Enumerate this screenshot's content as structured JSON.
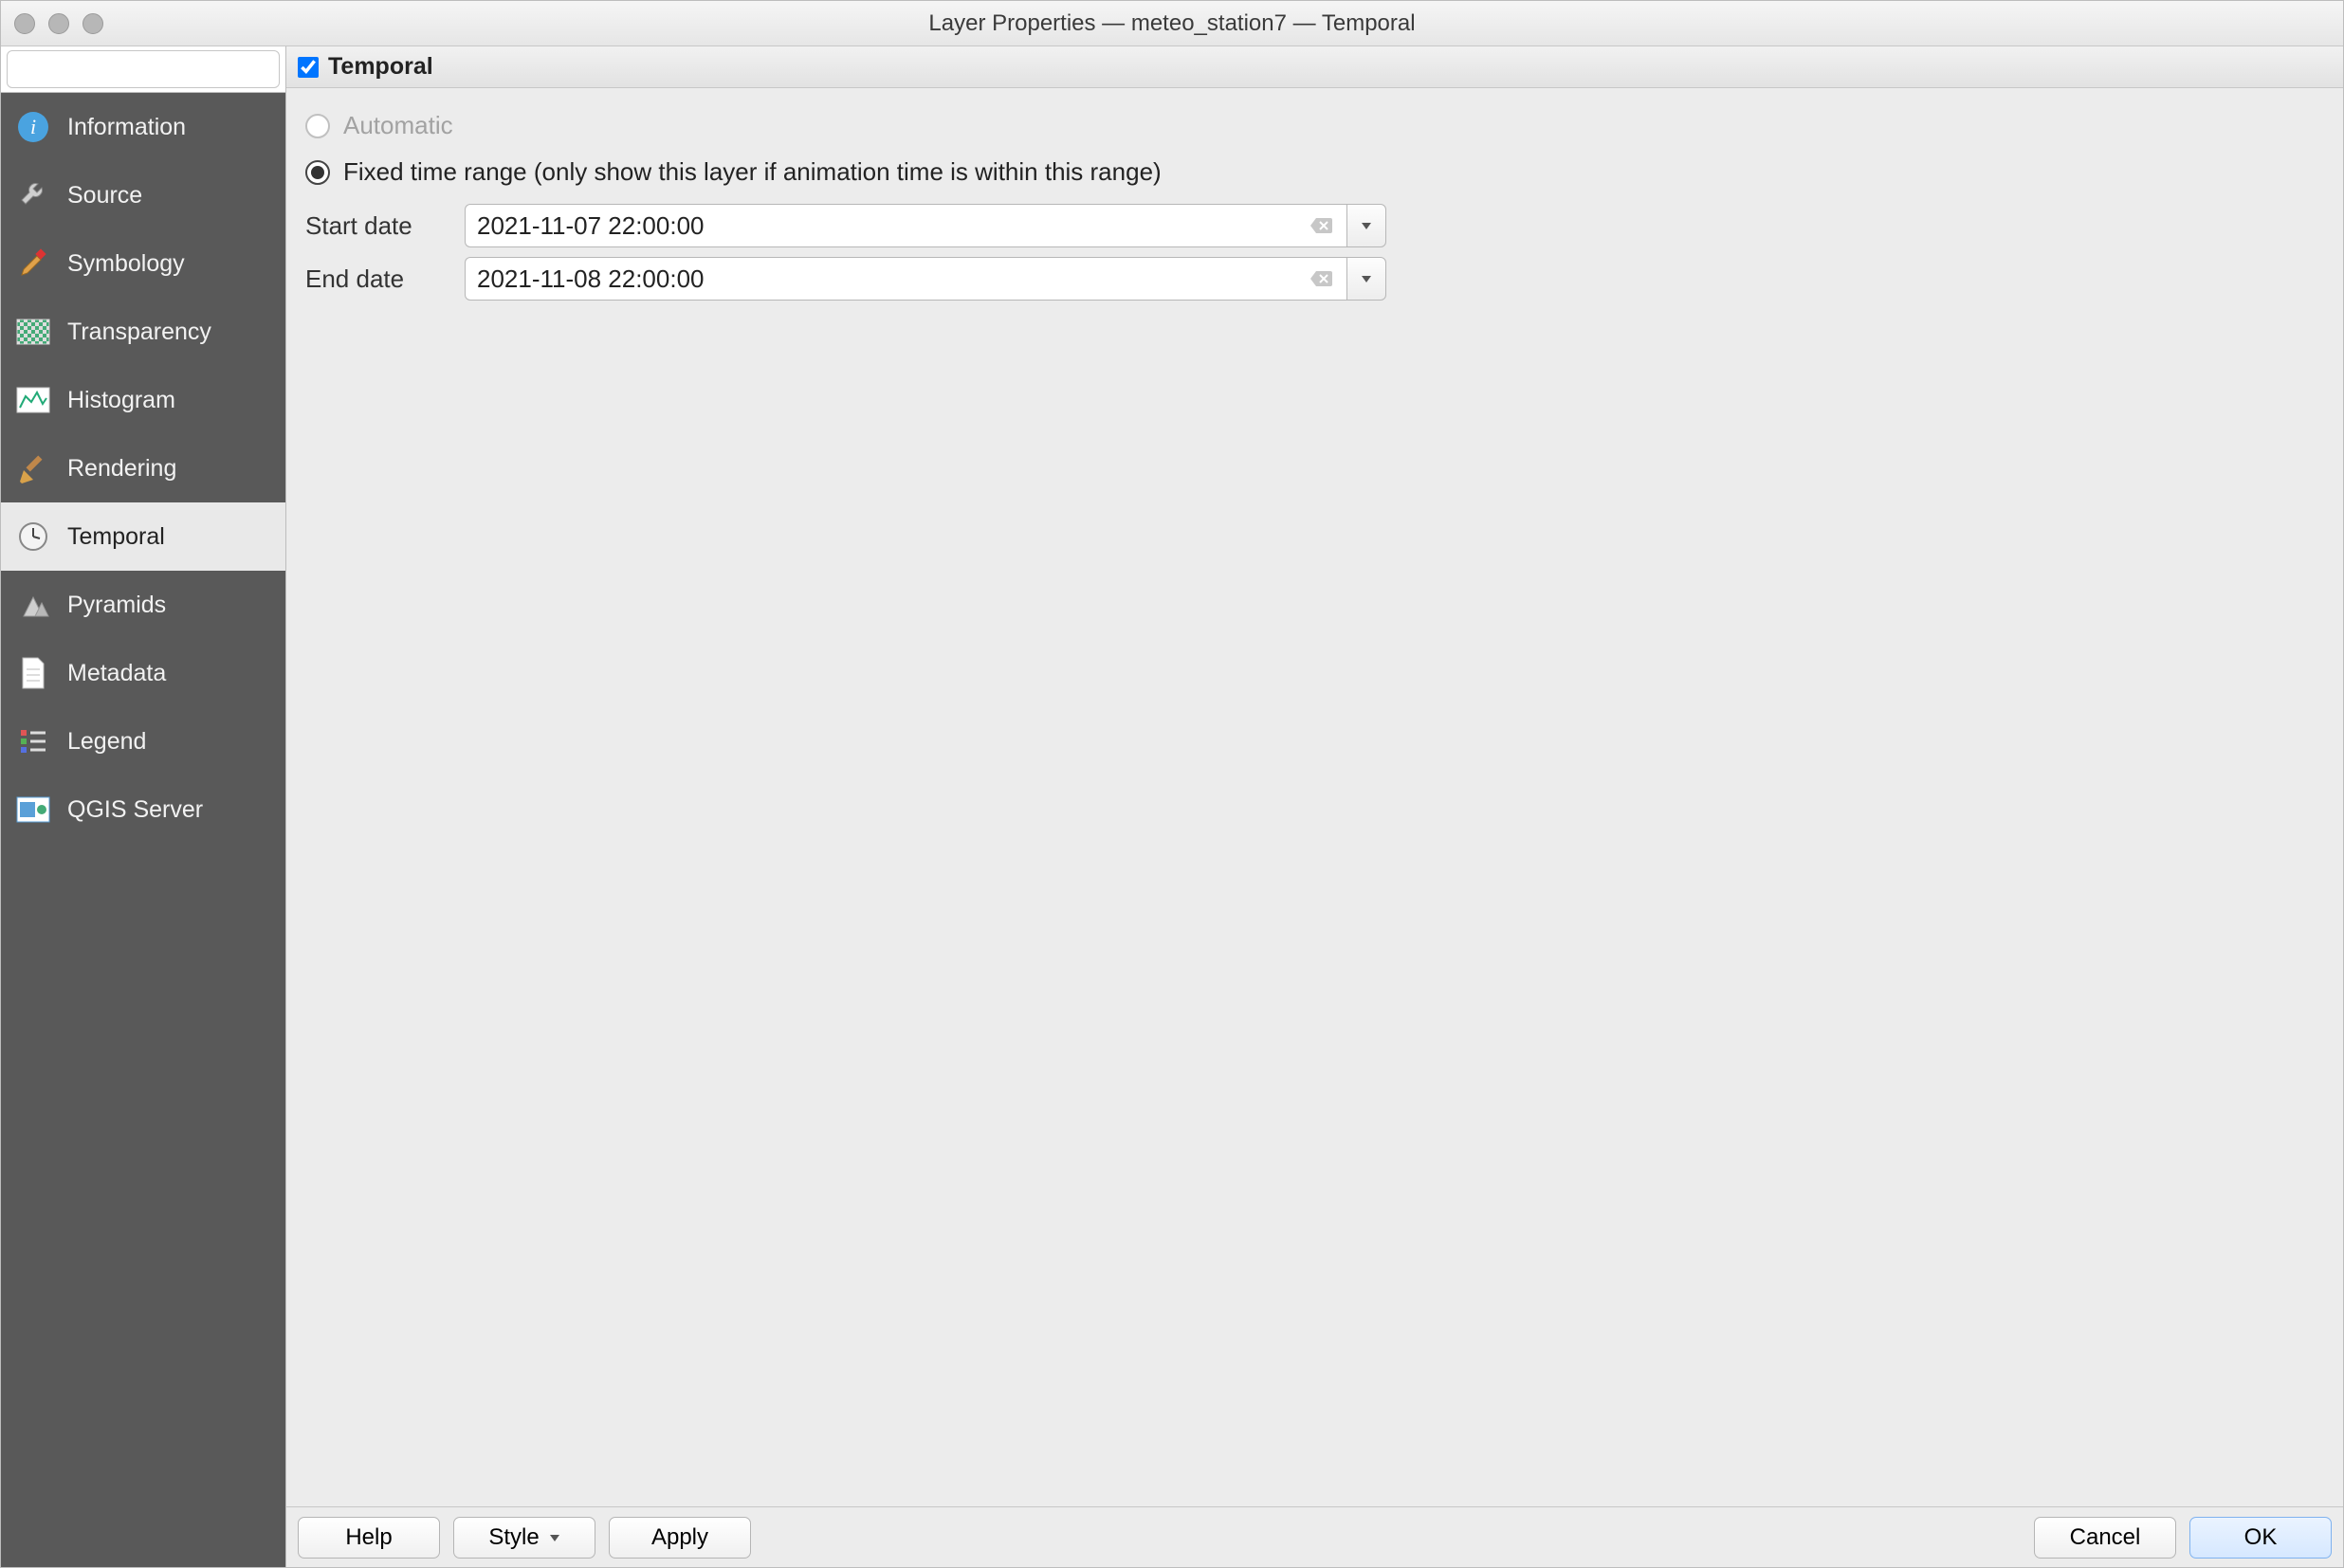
{
  "window": {
    "title": "Layer Properties — meteo_station7 — Temporal"
  },
  "search": {
    "placeholder": ""
  },
  "sidebar": {
    "items": [
      {
        "id": "information",
        "label": "Information"
      },
      {
        "id": "source",
        "label": "Source"
      },
      {
        "id": "symbology",
        "label": "Symbology"
      },
      {
        "id": "transparency",
        "label": "Transparency"
      },
      {
        "id": "histogram",
        "label": "Histogram"
      },
      {
        "id": "rendering",
        "label": "Rendering"
      },
      {
        "id": "temporal",
        "label": "Temporal"
      },
      {
        "id": "pyramids",
        "label": "Pyramids"
      },
      {
        "id": "metadata",
        "label": "Metadata"
      },
      {
        "id": "legend",
        "label": "Legend"
      },
      {
        "id": "qgisserver",
        "label": "QGIS Server"
      }
    ],
    "active_index": 6
  },
  "main": {
    "panel_title": "Temporal",
    "panel_enabled": true,
    "options": {
      "automatic": {
        "label": "Automatic",
        "selected": false,
        "enabled": false
      },
      "fixed": {
        "label": "Fixed time range (only show this layer if animation time is within this range)",
        "selected": true
      }
    },
    "dates": {
      "start": {
        "label": "Start date",
        "value": "2021-11-07 22:00:00"
      },
      "end": {
        "label": "End date",
        "value": "2021-11-08 22:00:00"
      }
    }
  },
  "footer": {
    "help": "Help",
    "style": "Style",
    "apply": "Apply",
    "cancel": "Cancel",
    "ok": "OK"
  }
}
